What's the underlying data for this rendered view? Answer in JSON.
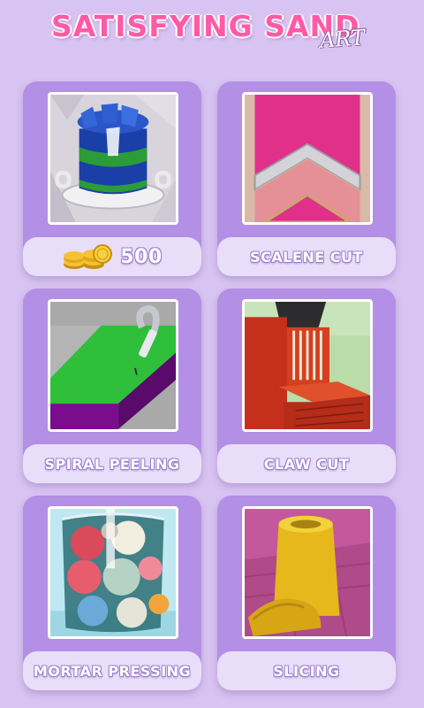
{
  "header": {
    "title_main": "SATISFYING SAND",
    "title_sub": "ART"
  },
  "cards": [
    {
      "label": "",
      "price": "500",
      "icon": "gold-coins-icon"
    },
    {
      "label": "SCALENE CUT"
    },
    {
      "label": "SPIRAL PEELING"
    },
    {
      "label": "CLAW CUT"
    },
    {
      "label": "MORTAR PRESSING"
    },
    {
      "label": "SLICING"
    }
  ],
  "colors": {
    "background": "#d8c4f2",
    "card": "#b38fe6",
    "label_bar": "#e9defa",
    "title_pink": "#ff5aa6"
  }
}
